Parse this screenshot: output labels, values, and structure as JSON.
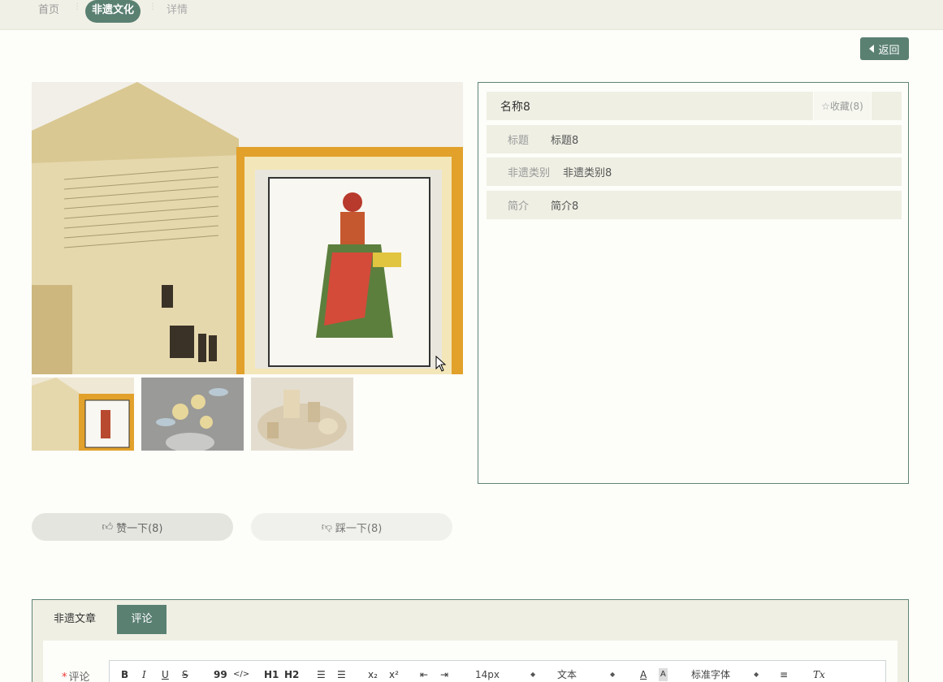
{
  "breadcrumb": {
    "home": "首页",
    "section": "非遗文化",
    "current": "详情"
  },
  "back_button": "返回",
  "gallery": {
    "thumbnails": [
      "thumbnail-1",
      "thumbnail-2",
      "thumbnail-3"
    ],
    "next_icon": "chevron-right-icon"
  },
  "detail": {
    "name": "名称8",
    "favorite": "☆收藏(8)",
    "rows": [
      {
        "label": "标题",
        "value": "标题8"
      },
      {
        "label": "非遗类别",
        "value": "非遗类别8"
      },
      {
        "label": "简介",
        "value": "简介8"
      }
    ]
  },
  "votes": {
    "like": "赞一下(8)",
    "dislike": "踩一下(8)"
  },
  "tabs": {
    "article": "非遗文章",
    "comment": "评论"
  },
  "comment": {
    "label": "评论",
    "required_mark": "*",
    "toolbar": {
      "bold": "B",
      "italic": "I",
      "underline": "U",
      "strike": "S",
      "quote": "99",
      "code": "</>",
      "h1": "H1",
      "h2": "H2",
      "sub": "x₂",
      "sup": "x²",
      "font_size": "14px",
      "block_type": "文本",
      "font_family": "标准字体",
      "clear": "Tx"
    }
  },
  "colors": {
    "accent": "#5a8072",
    "panel_bg": "#efefe4",
    "border": "#5f8576"
  }
}
